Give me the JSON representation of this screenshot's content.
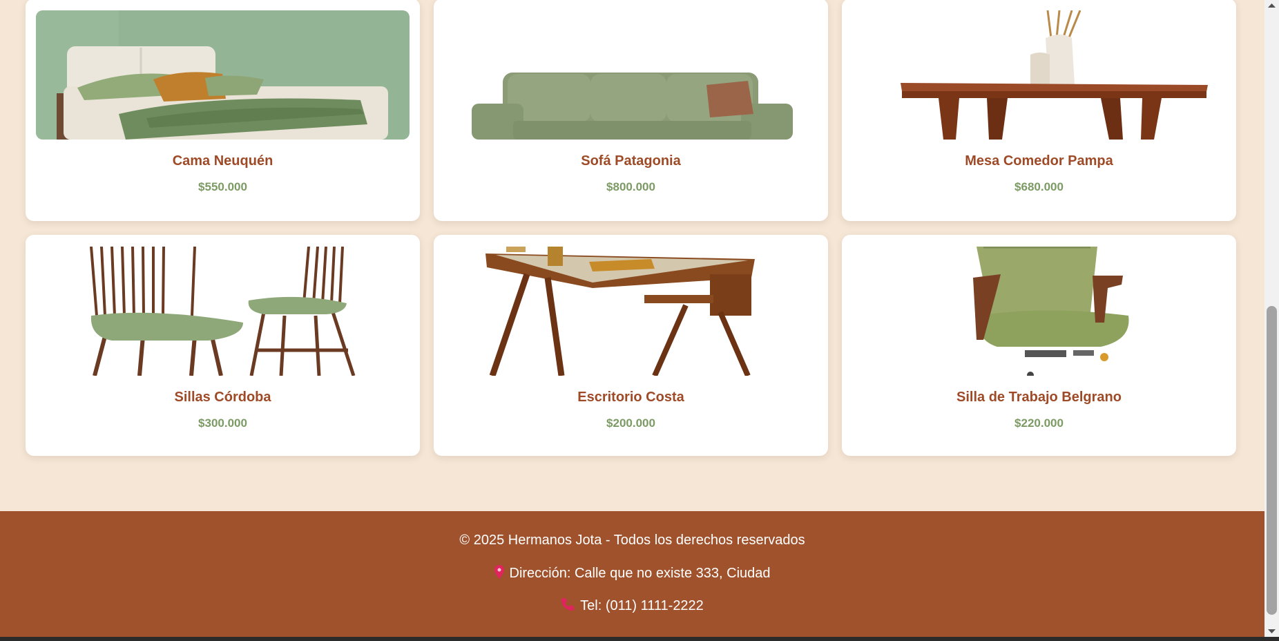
{
  "colors": {
    "page_background": "#f5e6d6",
    "card_background": "#ffffff",
    "product_name": "#9e4a27",
    "product_price": "#7c9a63",
    "footer_background": "#a0522d",
    "footer_text": "#ffffff"
  },
  "products": [
    {
      "name": "Cama Neuquén",
      "price": "$550.000",
      "image": "bed-image"
    },
    {
      "name": "Sofá Patagonia",
      "price": "$800.000",
      "image": "sofa-image"
    },
    {
      "name": "Mesa Comedor Pampa",
      "price": "$680.000",
      "image": "dining-table-image"
    },
    {
      "name": "Sillas Córdoba",
      "price": "$300.000",
      "image": "chairs-image"
    },
    {
      "name": "Escritorio Costa",
      "price": "$200.000",
      "image": "desk-image"
    },
    {
      "name": "Silla de Trabajo Belgrano",
      "price": "$220.000",
      "image": "office-chair-image"
    }
  ],
  "footer": {
    "copyright": "© 2025 Hermanos Jota - Todos los derechos reservados",
    "address": "Dirección: Calle que no existe 333, Ciudad",
    "phone": "Tel: (011) 1111-2222",
    "address_icon": "pin-icon",
    "phone_icon": "phone-icon"
  }
}
